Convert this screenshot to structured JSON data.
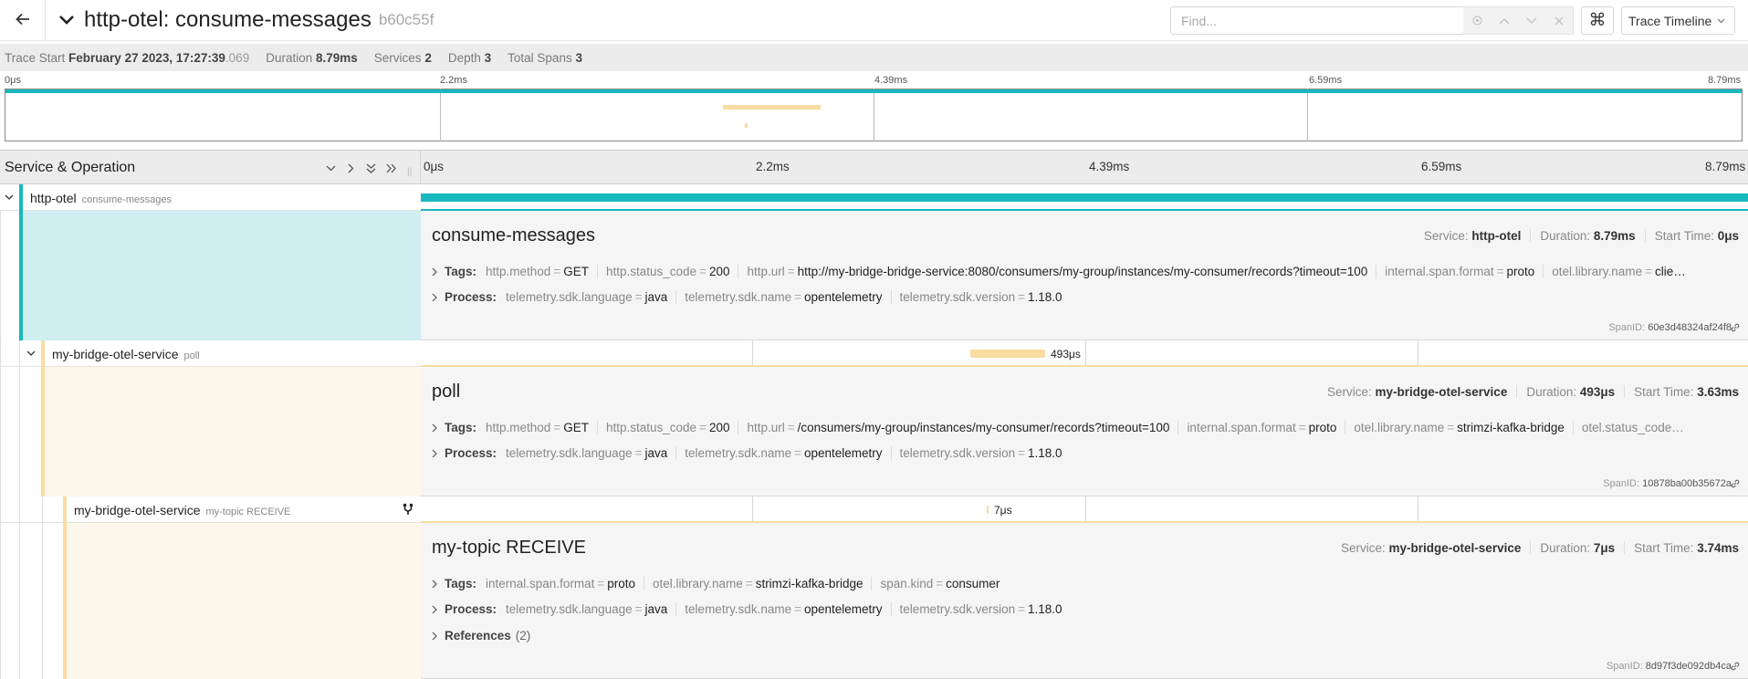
{
  "header": {
    "title": "http-otel: consume-messages",
    "trace_id": "b60c55f",
    "find_placeholder": "Find...",
    "kbd_glyph": "⌘",
    "view_select": "Trace Timeline"
  },
  "summary": {
    "trace_start_label": "Trace Start",
    "trace_start_value": "February 27 2023, 17:27:39",
    "trace_start_ms": ".069",
    "duration_label": "Duration",
    "duration_value": "8.79ms",
    "services_label": "Services",
    "services_value": "2",
    "depth_label": "Depth",
    "depth_value": "3",
    "total_spans_label": "Total Spans",
    "total_spans_value": "3"
  },
  "minimap": {
    "ticks": [
      "0μs",
      "2.2ms",
      "4.39ms",
      "6.59ms",
      "8.79ms"
    ]
  },
  "timeline_header": {
    "title": "Service & Operation",
    "ticks": [
      "0μs",
      "2.2ms",
      "4.39ms",
      "6.59ms",
      "8.79ms"
    ]
  },
  "colors": {
    "http_otel": "#17b8be",
    "bridge": "#f8dca1",
    "bridge_bg": "#fdf6ea",
    "http_bg": "#d0eef0"
  },
  "spans": [
    {
      "service": "http-otel",
      "operation": "consume-messages",
      "duration_label": "",
      "detail": {
        "op": "consume-messages",
        "service_label": "Service:",
        "service": "http-otel",
        "duration_label": "Duration:",
        "duration": "8.79ms",
        "start_label": "Start Time:",
        "start": "0μs",
        "tags_label": "Tags:",
        "tags": [
          {
            "k": "http.method",
            "v": "GET"
          },
          {
            "k": "http.status_code",
            "v": "200"
          },
          {
            "k": "http.url",
            "v": "http://my-bridge-bridge-service:8080/consumers/my-group/instances/my-consumer/records?timeout=100"
          },
          {
            "k": "internal.span.format",
            "v": "proto"
          },
          {
            "k": "otel.library.name",
            "v": "clie…"
          }
        ],
        "process_label": "Process:",
        "process": [
          {
            "k": "telemetry.sdk.language",
            "v": "java"
          },
          {
            "k": "telemetry.sdk.name",
            "v": "opentelemetry"
          },
          {
            "k": "telemetry.sdk.version",
            "v": "1.18.0"
          }
        ],
        "spanid_label": "SpanID:",
        "spanid": "60e3d48324af24f8"
      }
    },
    {
      "service": "my-bridge-otel-service",
      "operation": "poll",
      "duration_label": "493μs",
      "detail": {
        "op": "poll",
        "service_label": "Service:",
        "service": "my-bridge-otel-service",
        "duration_label": "Duration:",
        "duration": "493μs",
        "start_label": "Start Time:",
        "start": "3.63ms",
        "tags_label": "Tags:",
        "tags": [
          {
            "k": "http.method",
            "v": "GET"
          },
          {
            "k": "http.status_code",
            "v": "200"
          },
          {
            "k": "http.url",
            "v": "/consumers/my-group/instances/my-consumer/records?timeout=100"
          },
          {
            "k": "internal.span.format",
            "v": "proto"
          },
          {
            "k": "otel.library.name",
            "v": "strimzi-kafka-bridge"
          },
          {
            "k": "otel.status_code…",
            "v": ""
          }
        ],
        "process_label": "Process:",
        "process": [
          {
            "k": "telemetry.sdk.language",
            "v": "java"
          },
          {
            "k": "telemetry.sdk.name",
            "v": "opentelemetry"
          },
          {
            "k": "telemetry.sdk.version",
            "v": "1.18.0"
          }
        ],
        "spanid_label": "SpanID:",
        "spanid": "10878ba00b35672a"
      }
    },
    {
      "service": "my-bridge-otel-service",
      "operation": "my-topic RECEIVE",
      "duration_label": "7μs",
      "detail": {
        "op": "my-topic RECEIVE",
        "service_label": "Service:",
        "service": "my-bridge-otel-service",
        "duration_label": "Duration:",
        "duration": "7μs",
        "start_label": "Start Time:",
        "start": "3.74ms",
        "tags_label": "Tags:",
        "tags": [
          {
            "k": "internal.span.format",
            "v": "proto"
          },
          {
            "k": "otel.library.name",
            "v": "strimzi-kafka-bridge"
          },
          {
            "k": "span.kind",
            "v": "consumer"
          }
        ],
        "process_label": "Process:",
        "process": [
          {
            "k": "telemetry.sdk.language",
            "v": "java"
          },
          {
            "k": "telemetry.sdk.name",
            "v": "opentelemetry"
          },
          {
            "k": "telemetry.sdk.version",
            "v": "1.18.0"
          }
        ],
        "references_label": "References",
        "references_count": "(2)",
        "spanid_label": "SpanID:",
        "spanid": "8d97f3de092db4ca"
      }
    }
  ]
}
